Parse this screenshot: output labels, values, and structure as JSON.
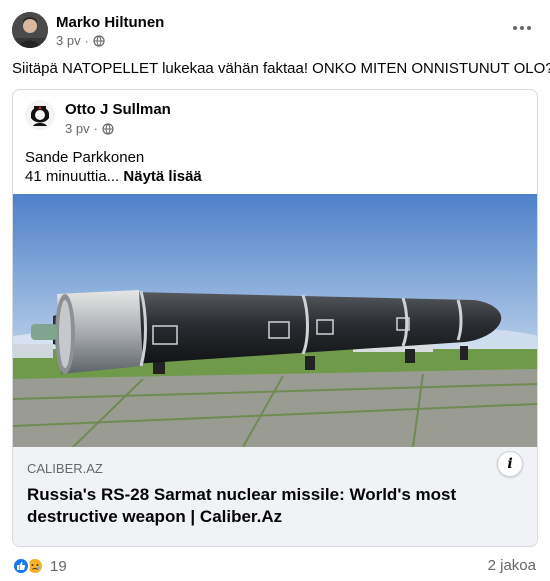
{
  "post": {
    "author": "Marko Hiltunen",
    "time": "3 pv",
    "text": "Siitäpä NATOPELLET lukekaa vähän faktaa! ONKO MITEN ONNISTUNUT OLO?!"
  },
  "shared_post": {
    "author": "Otto J Sullman",
    "time": "3 pv",
    "body_line1": "Sande Parkkonen",
    "body_line2": "41 minuuttia...",
    "see_more": "Näytä lisää"
  },
  "link": {
    "domain": "CALIBER.AZ",
    "title": "Russia's RS-28 Sarmat nuclear missile: World's most destructive weapon | Caliber.Az",
    "image_subject": "RS-28 Sarmat missile on display"
  },
  "footer": {
    "reaction_count": "19",
    "share_count": "2 jakoa"
  },
  "icons": {
    "privacy": "globe-icon",
    "more": "more-icon",
    "info": "info-icon",
    "like": "like-icon",
    "sad": "sad-icon"
  },
  "colors": {
    "secondary_text": "#65676b",
    "like_blue": "#1877f2",
    "sad_yellow": "#f7b125",
    "caption_bg": "#f0f2f5"
  }
}
